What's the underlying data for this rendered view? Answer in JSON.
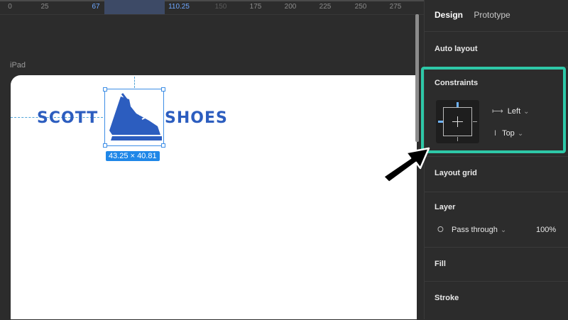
{
  "ruler": {
    "ticks": [
      "0",
      "25",
      "67",
      "110.25",
      "150",
      "175",
      "200",
      "225",
      "250",
      "275"
    ]
  },
  "canvas": {
    "frame_label": "iPad",
    "logo_left": "SCOTT",
    "logo_right": "SHOES",
    "size_badge": "43.25 × 40.81"
  },
  "panel": {
    "tabs": [
      "Design",
      "Prototype"
    ],
    "auto_layout": "Auto layout",
    "constraints": {
      "title": "Constraints",
      "horizontal": "Left",
      "vertical": "Top"
    },
    "layout_grid": "Layout grid",
    "layer": {
      "title": "Layer",
      "blend": "Pass through",
      "opacity": "100%"
    },
    "fill": "Fill",
    "stroke": "Stroke"
  },
  "colors": {
    "highlight": "#2ec8a8",
    "selection": "#3d8ee6",
    "logo": "#2c5dbf"
  }
}
